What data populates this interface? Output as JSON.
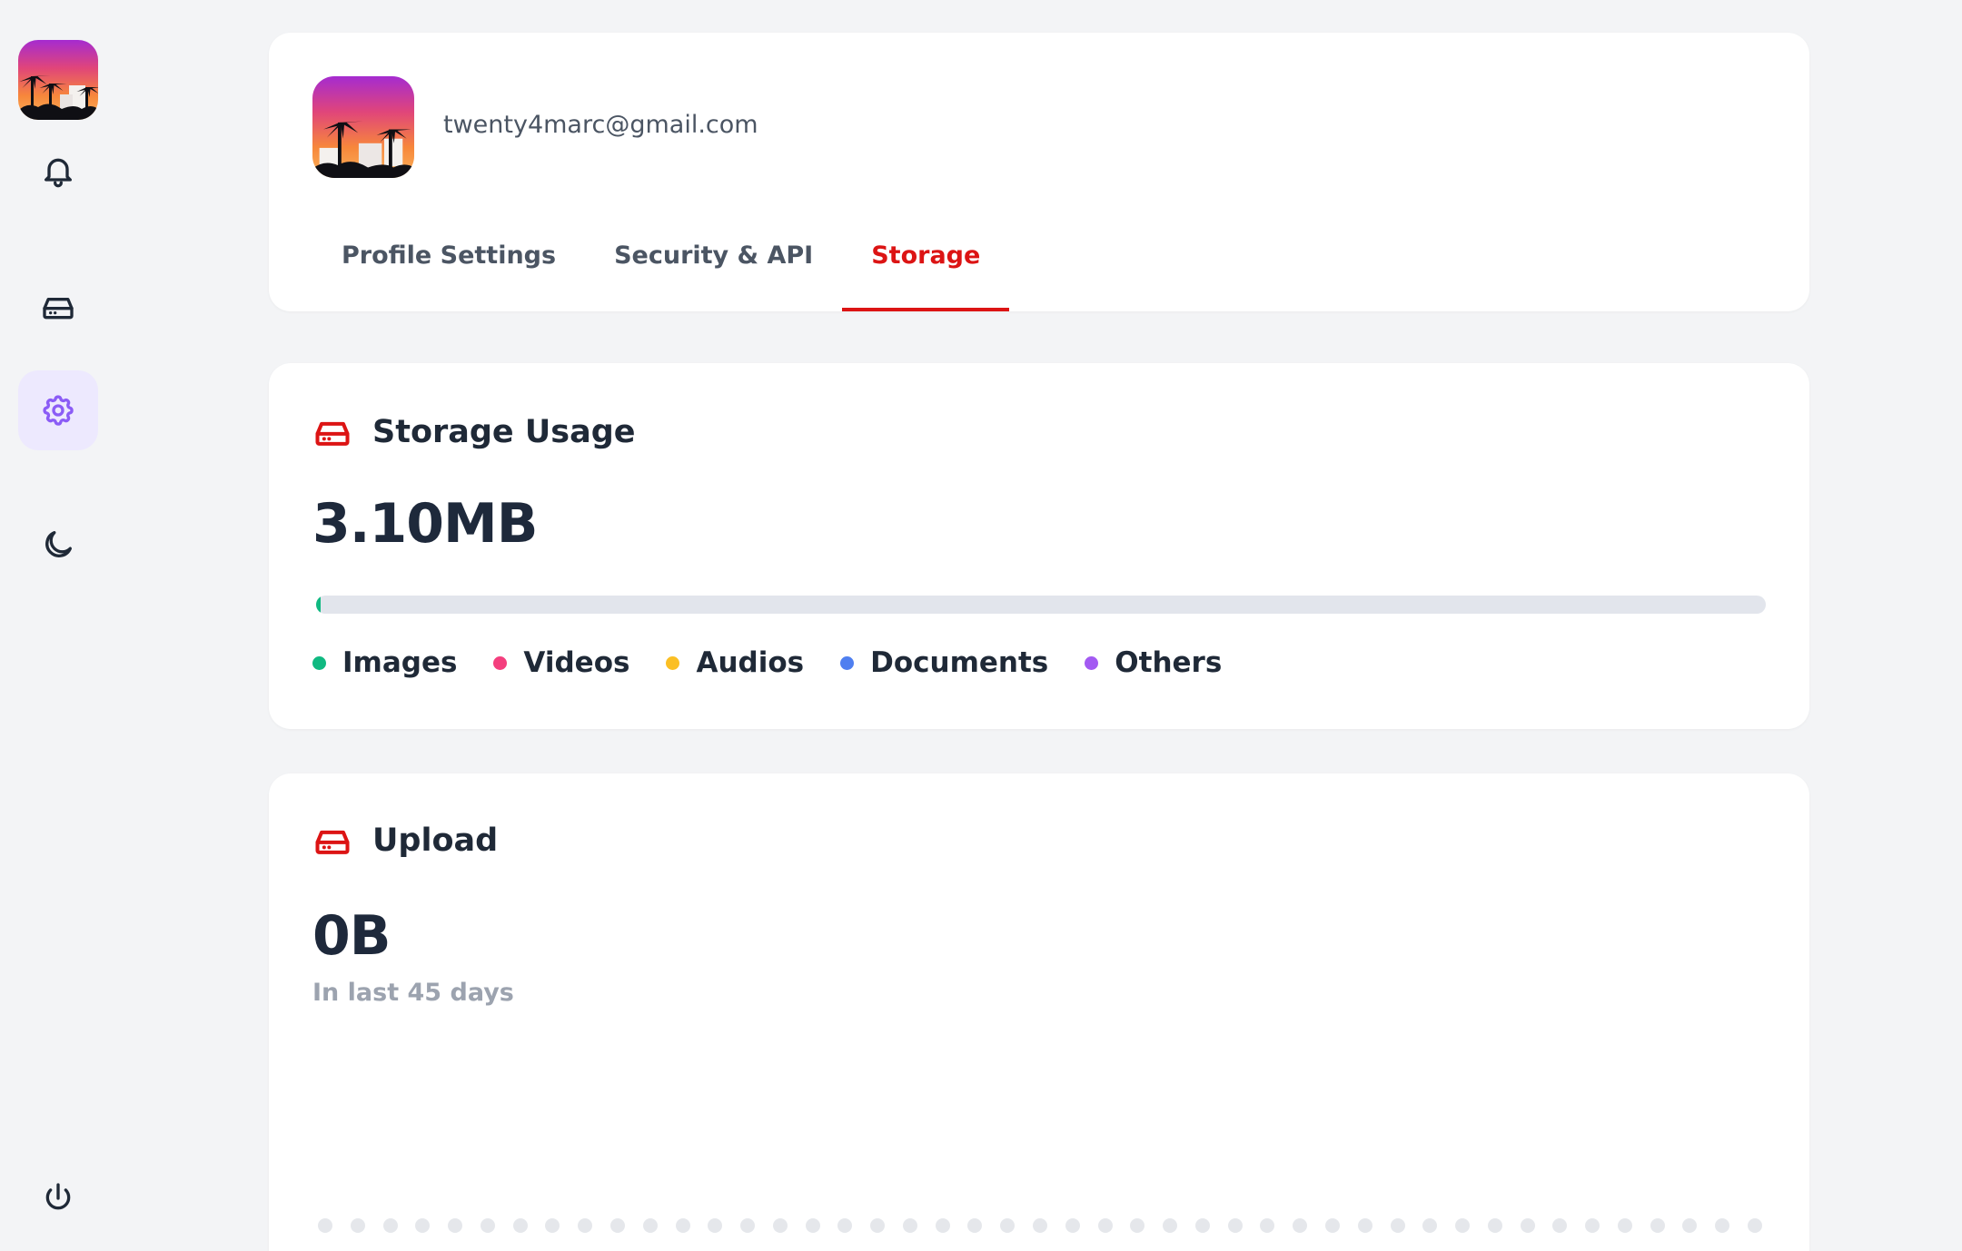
{
  "sidebar": {
    "items": [
      {
        "name": "avatar",
        "icon": "profile-image"
      },
      {
        "name": "notifications",
        "icon": "bell-icon"
      },
      {
        "name": "drive",
        "icon": "hard-drive-icon"
      },
      {
        "name": "settings",
        "icon": "gear-icon",
        "active": true
      },
      {
        "name": "theme",
        "icon": "moon-icon"
      },
      {
        "name": "logout",
        "icon": "power-icon"
      }
    ]
  },
  "profile": {
    "email": "twenty4marc@gmail.com",
    "tabs": [
      {
        "label": "Profile Settings",
        "active": false
      },
      {
        "label": "Security & API",
        "active": false
      },
      {
        "label": "Storage",
        "active": true
      }
    ]
  },
  "storage_usage": {
    "title": "Storage Usage",
    "value": "3.10MB",
    "bar_fill_percent": 0.3,
    "legend": [
      {
        "label": "Images",
        "color": "#10b981"
      },
      {
        "label": "Videos",
        "color": "#f43f7e"
      },
      {
        "label": "Audios",
        "color": "#fbbf24"
      },
      {
        "label": "Documents",
        "color": "#4f7ff0"
      },
      {
        "label": "Others",
        "color": "#a35af2"
      }
    ]
  },
  "upload": {
    "title": "Upload",
    "value": "0B",
    "subtitle": "In last 45 days",
    "day_count": 45
  },
  "colors": {
    "accent": "#dc1414",
    "active_nav": "#8b5cf6",
    "background": "#f3f4f6"
  }
}
